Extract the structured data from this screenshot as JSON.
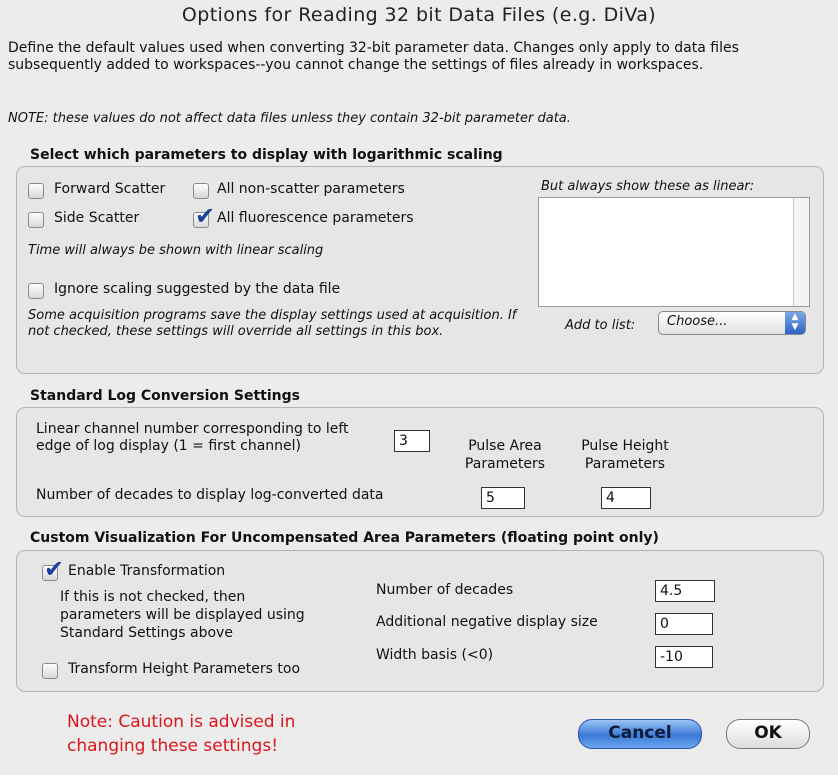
{
  "dialog": {
    "title": "Options for Reading 32 bit Data Files (e.g. DiVa)",
    "intro": "Define the default values used when converting 32-bit parameter data.  Changes only apply to data files subsequently added to workspaces--you cannot change the settings of files already in workspaces.",
    "note": "NOTE:  these values do not affect data files unless they contain 32-bit parameter data."
  },
  "log_scaling": {
    "title": "Select which parameters to display with logarithmic scaling",
    "forward_scatter": {
      "label": "Forward Scatter",
      "checked": false
    },
    "all_non_scatter": {
      "label": "All non-scatter parameters",
      "checked": false
    },
    "side_scatter": {
      "label": "Side Scatter",
      "checked": false
    },
    "all_fluorescence": {
      "label": "All fluorescence parameters",
      "checked": true
    },
    "time_note": "Time will always be shown with linear scaling",
    "ignore_scaling": {
      "label": "Ignore scaling suggested by the data file",
      "checked": false
    },
    "ignore_note": "Some acquisition programs save the display settings used at acquisition.  If not checked, these settings will override all settings in this box.",
    "linear_list_label": "But always show these as linear:",
    "linear_list_items": [],
    "add_to_list_label": "Add to list:",
    "add_to_list_value": "Choose..."
  },
  "log_conversion": {
    "title": "Standard Log Conversion Settings",
    "linear_channel_label": "Linear channel number corresponding to left edge of log display (1 = first channel)",
    "linear_channel_value": "3",
    "pulse_area_header": "Pulse Area Parameters",
    "pulse_height_header": "Pulse Height Parameters",
    "decades_label": "Number of decades to display log-converted data",
    "decades_area_value": "5",
    "decades_height_value": "4"
  },
  "custom_vis": {
    "title": "Custom Visualization For Uncompensated Area Parameters (floating point only)",
    "enable": {
      "label": "Enable Transformation",
      "checked": true
    },
    "enable_note": "If this is not checked, then parameters will be displayed using Standard Settings above",
    "transform_height": {
      "label": "Transform Height Parameters too",
      "checked": false
    },
    "num_decades_label": "Number of decades",
    "num_decades_value": "4.5",
    "neg_display_label": "Additional negative display size",
    "neg_display_value": "0",
    "width_basis_label": "Width basis (<0)",
    "width_basis_value": "-10"
  },
  "footer": {
    "warning_line1": "Note:   Caution is advised in",
    "warning_line2": "changing these settings!",
    "cancel_label": "Cancel",
    "ok_label": "OK"
  },
  "colors": {
    "background": "#ececec",
    "warning": "#e0141c",
    "accent_blue": "#3c7ad8"
  }
}
